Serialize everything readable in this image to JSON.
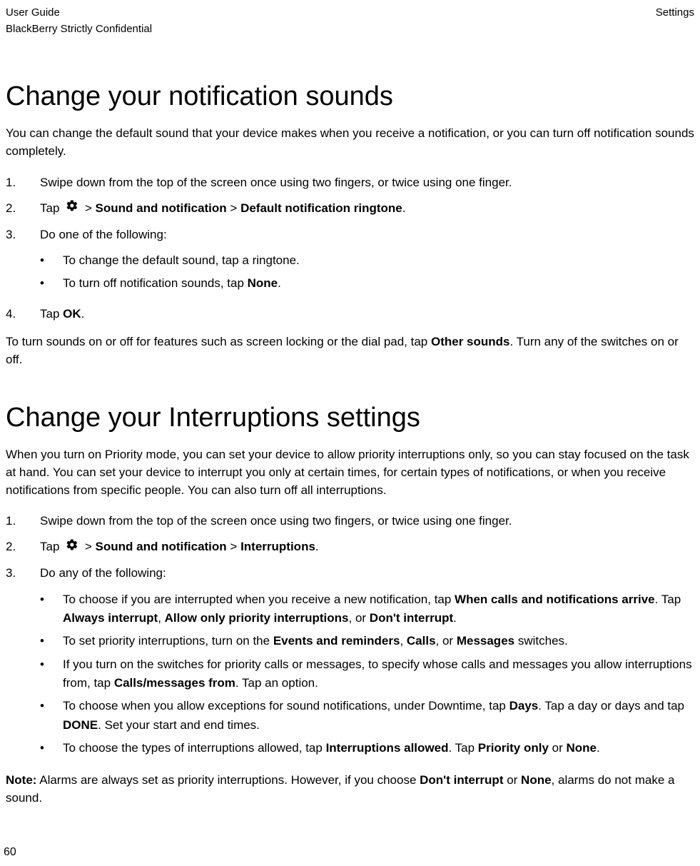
{
  "header": {
    "leftTop": "User Guide",
    "leftBottom": "BlackBerry Strictly Confidential",
    "right": "Settings"
  },
  "section1": {
    "title": "Change your notification sounds",
    "intro": "You can change the default sound that your device makes when you receive a notification, or you can turn off notification sounds completely.",
    "step1_num": "1.",
    "step1_text": "Swipe down from the top of the screen once using two fingers, or twice using one finger.",
    "step2_num": "2.",
    "step2_pre": "Tap ",
    "step2_gt1": " > ",
    "step2_b1": "Sound and notification",
    "step2_gt2": " > ",
    "step2_b2": "Default notification ringtone",
    "step2_dot": ".",
    "step3_num": "3.",
    "step3_text": "Do one of the following:",
    "bullet1": "To change the default sound, tap a ringtone.",
    "bullet2_pre": "To turn off notification sounds, tap ",
    "bullet2_b": "None",
    "bullet2_dot": ".",
    "step4_num": "4.",
    "step4_pre": "Tap ",
    "step4_b": "OK",
    "step4_dot": ".",
    "after_pre": "To turn sounds on or off for features such as screen locking or the dial pad, tap ",
    "after_b": "Other sounds",
    "after_post": ". Turn any of the switches on or off."
  },
  "section2": {
    "title": "Change your Interruptions settings",
    "intro": "When you turn on Priority mode, you can set your device to allow priority interruptions only, so you can stay focused on the task at hand. You can set your device to interrupt you only at certain times, for certain types of notifications, or when you receive notifications from specific people. You can also turn off all interruptions.",
    "step1_num": "1.",
    "step1_text": "Swipe down from the top of the screen once using two fingers, or twice using one finger.",
    "step2_num": "2.",
    "step2_pre": "Tap ",
    "step2_gt1": " > ",
    "step2_b1": "Sound and notification",
    "step2_gt2": " > ",
    "step2_b2": "Interruptions",
    "step2_dot": ".",
    "step3_num": "3.",
    "step3_text": "Do any of the following:",
    "b1_pre": "To choose if you are interrupted when you receive a new notification, tap ",
    "b1_b1": "When calls and notifications arrive",
    "b1_mid1": ". Tap ",
    "b1_b2": "Always interrupt",
    "b1_mid2": ", ",
    "b1_b3": "Allow only priority interruptions",
    "b1_mid3": ", or ",
    "b1_b4": "Don't interrupt",
    "b1_dot": ".",
    "b2_pre": "To set priority interruptions, turn on the ",
    "b2_b1": "Events and reminders",
    "b2_mid1": ", ",
    "b2_b2": "Calls",
    "b2_mid2": ", or ",
    "b2_b3": "Messages",
    "b2_post": " switches.",
    "b3_pre": "If you turn on the switches for priority calls or messages, to specify whose calls and messages you allow interruptions from, tap ",
    "b3_b1": "Calls/messages from",
    "b3_post": ". Tap an option.",
    "b4_pre": "To choose when you allow exceptions for sound notifications, under Downtime, tap ",
    "b4_b1": "Days",
    "b4_mid": ". Tap a day or days and tap ",
    "b4_b2": "DONE",
    "b4_post": ". Set your start and end times.",
    "b5_pre": "To choose the types of interruptions allowed, tap ",
    "b5_b1": "Interruptions allowed",
    "b5_mid": ". Tap ",
    "b5_b2": "Priority only",
    "b5_mid2": " or ",
    "b5_b3": "None",
    "b5_dot": ".",
    "note_b": "Note:",
    "note_pre": " Alarms are always set as priority interruptions. However, if you choose ",
    "note_b1": "Don't interrupt",
    "note_mid": " or ",
    "note_b2": "None",
    "note_post": ", alarms do not make a sound."
  },
  "pageNumber": "60",
  "bulletChar": "•"
}
